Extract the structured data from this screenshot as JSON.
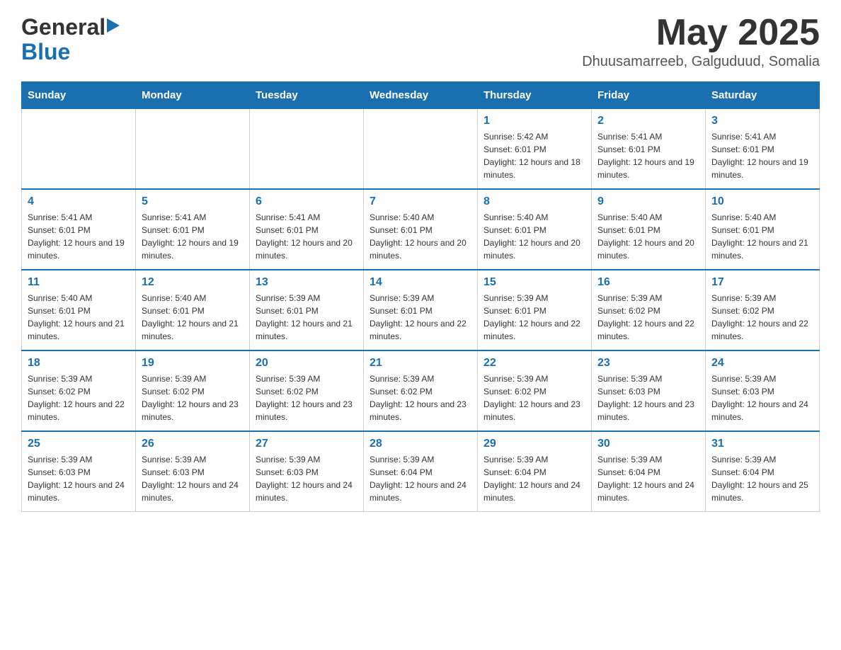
{
  "header": {
    "logo_line1": "General",
    "logo_line2": "Blue",
    "title": "May 2025",
    "location": "Dhuusamarreeb, Galguduud, Somalia"
  },
  "days_of_week": [
    "Sunday",
    "Monday",
    "Tuesday",
    "Wednesday",
    "Thursday",
    "Friday",
    "Saturday"
  ],
  "weeks": [
    {
      "cells": [
        {
          "day": null,
          "info": null
        },
        {
          "day": null,
          "info": null
        },
        {
          "day": null,
          "info": null
        },
        {
          "day": null,
          "info": null
        },
        {
          "day": "1",
          "info": "Sunrise: 5:42 AM\nSunset: 6:01 PM\nDaylight: 12 hours and 18 minutes."
        },
        {
          "day": "2",
          "info": "Sunrise: 5:41 AM\nSunset: 6:01 PM\nDaylight: 12 hours and 19 minutes."
        },
        {
          "day": "3",
          "info": "Sunrise: 5:41 AM\nSunset: 6:01 PM\nDaylight: 12 hours and 19 minutes."
        }
      ]
    },
    {
      "cells": [
        {
          "day": "4",
          "info": "Sunrise: 5:41 AM\nSunset: 6:01 PM\nDaylight: 12 hours and 19 minutes."
        },
        {
          "day": "5",
          "info": "Sunrise: 5:41 AM\nSunset: 6:01 PM\nDaylight: 12 hours and 19 minutes."
        },
        {
          "day": "6",
          "info": "Sunrise: 5:41 AM\nSunset: 6:01 PM\nDaylight: 12 hours and 20 minutes."
        },
        {
          "day": "7",
          "info": "Sunrise: 5:40 AM\nSunset: 6:01 PM\nDaylight: 12 hours and 20 minutes."
        },
        {
          "day": "8",
          "info": "Sunrise: 5:40 AM\nSunset: 6:01 PM\nDaylight: 12 hours and 20 minutes."
        },
        {
          "day": "9",
          "info": "Sunrise: 5:40 AM\nSunset: 6:01 PM\nDaylight: 12 hours and 20 minutes."
        },
        {
          "day": "10",
          "info": "Sunrise: 5:40 AM\nSunset: 6:01 PM\nDaylight: 12 hours and 21 minutes."
        }
      ]
    },
    {
      "cells": [
        {
          "day": "11",
          "info": "Sunrise: 5:40 AM\nSunset: 6:01 PM\nDaylight: 12 hours and 21 minutes."
        },
        {
          "day": "12",
          "info": "Sunrise: 5:40 AM\nSunset: 6:01 PM\nDaylight: 12 hours and 21 minutes."
        },
        {
          "day": "13",
          "info": "Sunrise: 5:39 AM\nSunset: 6:01 PM\nDaylight: 12 hours and 21 minutes."
        },
        {
          "day": "14",
          "info": "Sunrise: 5:39 AM\nSunset: 6:01 PM\nDaylight: 12 hours and 22 minutes."
        },
        {
          "day": "15",
          "info": "Sunrise: 5:39 AM\nSunset: 6:01 PM\nDaylight: 12 hours and 22 minutes."
        },
        {
          "day": "16",
          "info": "Sunrise: 5:39 AM\nSunset: 6:02 PM\nDaylight: 12 hours and 22 minutes."
        },
        {
          "day": "17",
          "info": "Sunrise: 5:39 AM\nSunset: 6:02 PM\nDaylight: 12 hours and 22 minutes."
        }
      ]
    },
    {
      "cells": [
        {
          "day": "18",
          "info": "Sunrise: 5:39 AM\nSunset: 6:02 PM\nDaylight: 12 hours and 22 minutes."
        },
        {
          "day": "19",
          "info": "Sunrise: 5:39 AM\nSunset: 6:02 PM\nDaylight: 12 hours and 23 minutes."
        },
        {
          "day": "20",
          "info": "Sunrise: 5:39 AM\nSunset: 6:02 PM\nDaylight: 12 hours and 23 minutes."
        },
        {
          "day": "21",
          "info": "Sunrise: 5:39 AM\nSunset: 6:02 PM\nDaylight: 12 hours and 23 minutes."
        },
        {
          "day": "22",
          "info": "Sunrise: 5:39 AM\nSunset: 6:02 PM\nDaylight: 12 hours and 23 minutes."
        },
        {
          "day": "23",
          "info": "Sunrise: 5:39 AM\nSunset: 6:03 PM\nDaylight: 12 hours and 23 minutes."
        },
        {
          "day": "24",
          "info": "Sunrise: 5:39 AM\nSunset: 6:03 PM\nDaylight: 12 hours and 24 minutes."
        }
      ]
    },
    {
      "cells": [
        {
          "day": "25",
          "info": "Sunrise: 5:39 AM\nSunset: 6:03 PM\nDaylight: 12 hours and 24 minutes."
        },
        {
          "day": "26",
          "info": "Sunrise: 5:39 AM\nSunset: 6:03 PM\nDaylight: 12 hours and 24 minutes."
        },
        {
          "day": "27",
          "info": "Sunrise: 5:39 AM\nSunset: 6:03 PM\nDaylight: 12 hours and 24 minutes."
        },
        {
          "day": "28",
          "info": "Sunrise: 5:39 AM\nSunset: 6:04 PM\nDaylight: 12 hours and 24 minutes."
        },
        {
          "day": "29",
          "info": "Sunrise: 5:39 AM\nSunset: 6:04 PM\nDaylight: 12 hours and 24 minutes."
        },
        {
          "day": "30",
          "info": "Sunrise: 5:39 AM\nSunset: 6:04 PM\nDaylight: 12 hours and 24 minutes."
        },
        {
          "day": "31",
          "info": "Sunrise: 5:39 AM\nSunset: 6:04 PM\nDaylight: 12 hours and 25 minutes."
        }
      ]
    }
  ]
}
